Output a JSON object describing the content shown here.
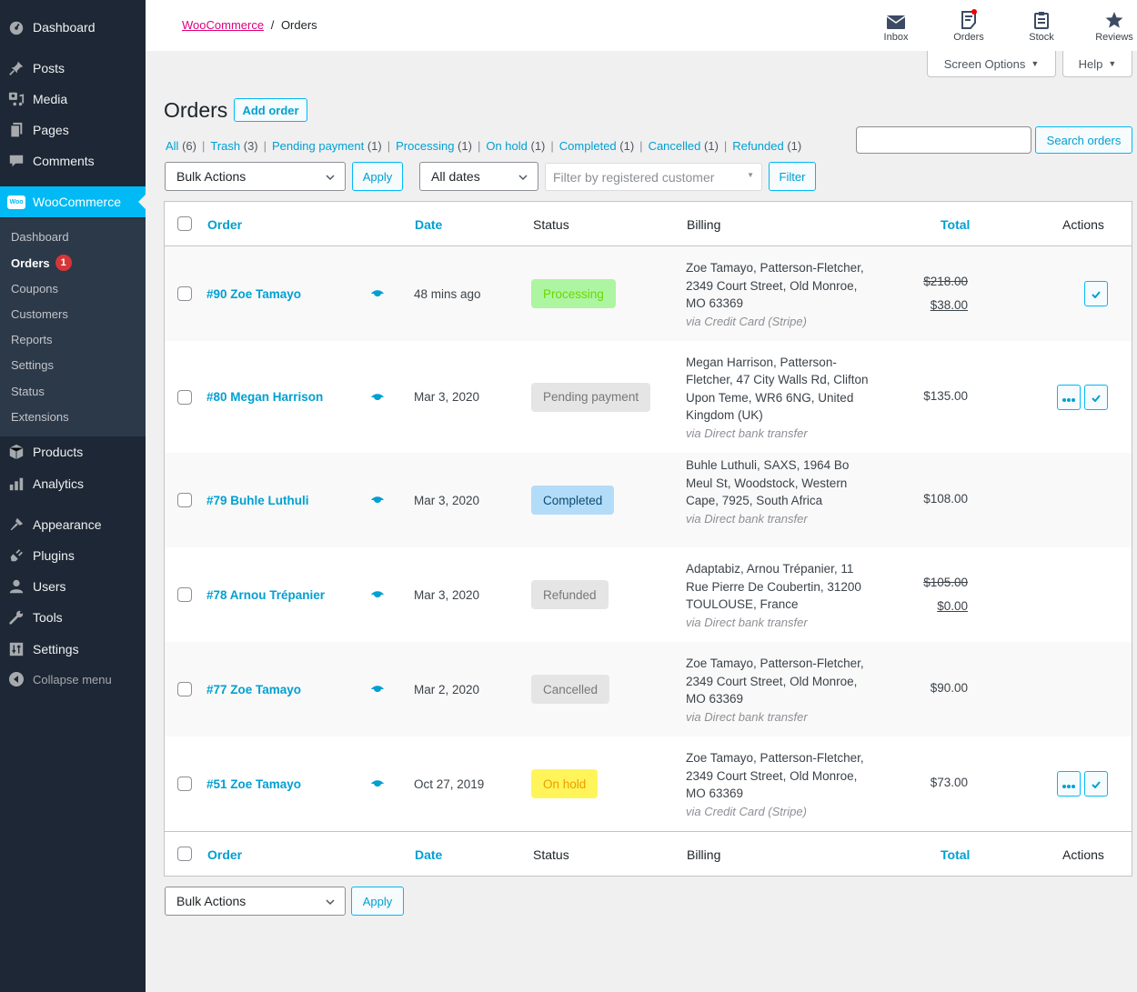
{
  "sidebar": {
    "top_items": [
      {
        "label": "Dashboard",
        "icon": "dashboard-icon"
      },
      {
        "label": "Posts",
        "icon": "pin-icon"
      },
      {
        "label": "Media",
        "icon": "media-icon"
      },
      {
        "label": "Pages",
        "icon": "pages-icon"
      },
      {
        "label": "Comments",
        "icon": "comment-icon"
      }
    ],
    "active_item": {
      "label": "WooCommerce",
      "icon": "woo-icon",
      "icon_text": "Woo"
    },
    "submenu": [
      {
        "label": "Dashboard"
      },
      {
        "label": "Orders",
        "badge": "1",
        "current": true
      },
      {
        "label": "Coupons"
      },
      {
        "label": "Customers"
      },
      {
        "label": "Reports"
      },
      {
        "label": "Settings"
      },
      {
        "label": "Status"
      },
      {
        "label": "Extensions"
      }
    ],
    "bottom_items": [
      {
        "label": "Products",
        "icon": "box-icon"
      },
      {
        "label": "Analytics",
        "icon": "bar-chart-icon"
      },
      {
        "label": "Appearance",
        "icon": "brush-icon"
      },
      {
        "label": "Plugins",
        "icon": "plug-icon"
      },
      {
        "label": "Users",
        "icon": "user-icon"
      },
      {
        "label": "Tools",
        "icon": "wrench-icon"
      },
      {
        "label": "Settings",
        "icon": "sliders-icon"
      }
    ],
    "collapse_label": "Collapse menu"
  },
  "header": {
    "breadcrumb_link": "WooCommerce",
    "breadcrumb_sep": "/",
    "breadcrumb_current": "Orders",
    "activity": [
      {
        "label": "Inbox",
        "icon": "envelope-icon"
      },
      {
        "label": "Orders",
        "icon": "orders-icon",
        "has_dot": true
      },
      {
        "label": "Stock",
        "icon": "clipboard-icon"
      },
      {
        "label": "Reviews",
        "icon": "star-icon"
      }
    ],
    "screen_options": "Screen Options",
    "help": "Help"
  },
  "page": {
    "title": "Orders",
    "add_order": "Add order"
  },
  "status_filters": [
    {
      "label": "All",
      "count": "(6)"
    },
    {
      "label": "Trash",
      "count": "(3)"
    },
    {
      "label": "Pending payment",
      "count": "(1)"
    },
    {
      "label": "Processing",
      "count": "(1)"
    },
    {
      "label": "On hold",
      "count": "(1)"
    },
    {
      "label": "Completed",
      "count": "(1)"
    },
    {
      "label": "Cancelled",
      "count": "(1)"
    },
    {
      "label": "Refunded",
      "count": "(1)"
    }
  ],
  "search": {
    "value": "",
    "button": "Search orders"
  },
  "toolbar": {
    "bulk_actions": "Bulk Actions",
    "apply": "Apply",
    "dates": "All dates",
    "customer_placeholder": "Filter by registered customer",
    "filter": "Filter"
  },
  "table": {
    "columns": {
      "order": "Order",
      "date": "Date",
      "status": "Status",
      "billing": "Billing",
      "total": "Total",
      "actions": "Actions"
    },
    "rows": [
      {
        "order": "#90 Zoe Tamayo",
        "date": "48 mins ago",
        "status": "Processing",
        "status_bg": "#aef5a2",
        "status_fg": "#69d900",
        "billing": "Zoe Tamayo, Patterson-Fletcher, 2349 Court Street, Old Monroe, MO 63369",
        "via": "via Credit Card (Stripe)",
        "total_original": "$218.00",
        "total": "$38.00",
        "actions": [
          "complete"
        ]
      },
      {
        "order": "#80 Megan Harrison",
        "date": "Mar 3, 2020",
        "status": "Pending payment",
        "status_bg": "#e5e5e5",
        "status_fg": "#777777",
        "billing": "Megan Harrison, Patterson-Fletcher, 47 City Walls Rd, Clifton Upon Teme, WR6 6NG, United Kingdom (UK)",
        "via": "via Direct bank transfer",
        "total_original": "",
        "total": "$135.00",
        "actions": [
          "processing",
          "complete"
        ]
      },
      {
        "order": "#79 Buhle Luthuli",
        "date": "Mar 3, 2020",
        "status": "Completed",
        "status_bg": "#b3dcf8",
        "status_fg": "#0c4a73",
        "billing": "Buhle Luthuli, SAXS, 1964 Bo Meul St, Woodstock, Western Cape, 7925, South Africa",
        "via": "via Direct bank transfer",
        "total_original": "",
        "total": "$108.00",
        "actions": []
      },
      {
        "order": "#78 Arnou Trépanier",
        "date": "Mar 3, 2020",
        "status": "Refunded",
        "status_bg": "#e5e5e5",
        "status_fg": "#777777",
        "billing": "Adaptabiz, Arnou Trépanier, 11 Rue Pierre De Coubertin, 31200 TOULOUSE, France",
        "via": "via Direct bank transfer",
        "total_original": "$105.00",
        "total": "$0.00",
        "actions": []
      },
      {
        "order": "#77 Zoe Tamayo",
        "date": "Mar 2, 2020",
        "status": "Cancelled",
        "status_bg": "#e5e5e5",
        "status_fg": "#777777",
        "billing": "Zoe Tamayo, Patterson-Fletcher, 2349 Court Street, Old Monroe, MO 63369",
        "via": "via Direct bank transfer",
        "total_original": "",
        "total": "$90.00",
        "actions": []
      },
      {
        "order": "#51 Zoe Tamayo",
        "date": "Oct 27, 2019",
        "status": "On hold",
        "status_bg": "#fff55a",
        "status_fg": "#f09a00",
        "billing": "Zoe Tamayo, Patterson-Fletcher, 2349 Court Street, Old Monroe, MO 63369",
        "via": "via Credit Card (Stripe)",
        "total_original": "",
        "total": "$73.00",
        "actions": [
          "processing",
          "complete"
        ]
      }
    ]
  },
  "colors": {
    "accent": "#00a0d2",
    "woo_active": "#00b9f5",
    "breadcrumb_link": "#e0007d",
    "sidebar_bg": "#1d2735",
    "submenu_bg": "#2c3949"
  }
}
